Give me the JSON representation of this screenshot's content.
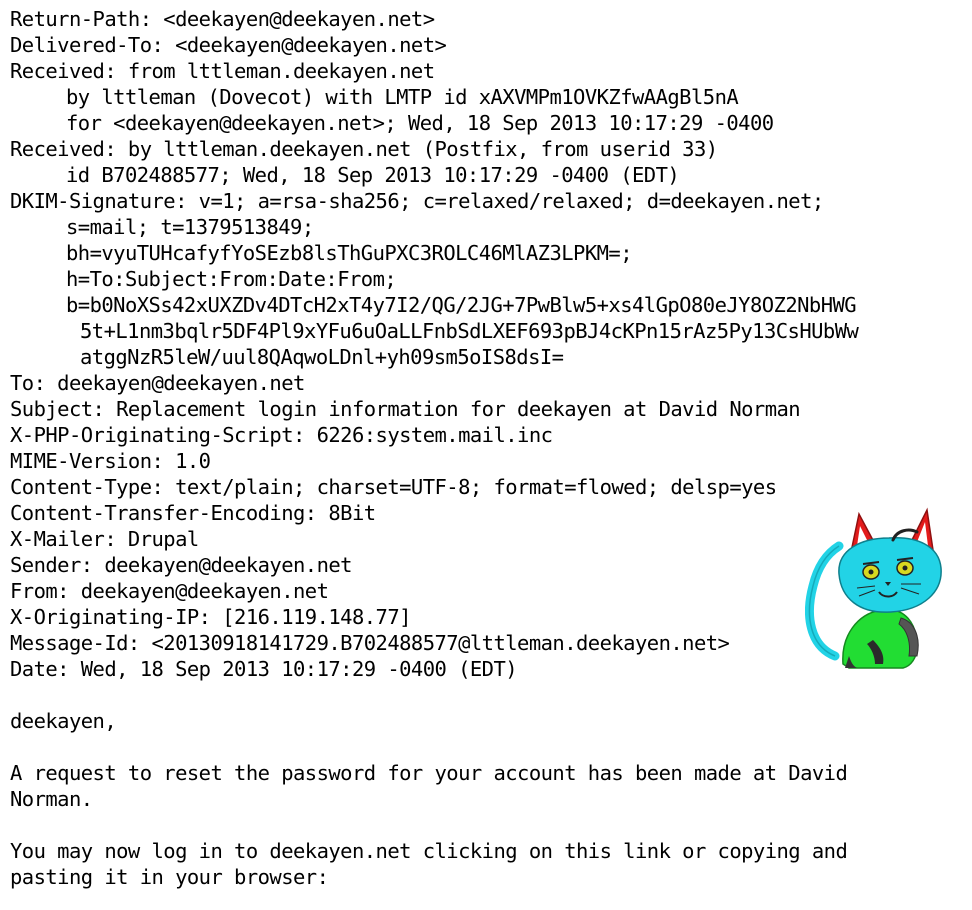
{
  "headers": [
    {
      "text": "Return-Path: <deekayen@deekayen.net>",
      "indent": 0
    },
    {
      "text": "Delivered-To: <deekayen@deekayen.net>",
      "indent": 0
    },
    {
      "text": "Received: from lttleman.deekayen.net",
      "indent": 0
    },
    {
      "text": "by lttleman (Dovecot) with LMTP id xAXVMPm1OVKZfwAAgBl5nA",
      "indent": 1
    },
    {
      "text": "for <deekayen@deekayen.net>; Wed, 18 Sep 2013 10:17:29 -0400",
      "indent": 1
    },
    {
      "text": "Received: by lttleman.deekayen.net (Postfix, from userid 33)",
      "indent": 0
    },
    {
      "text": "id B702488577; Wed, 18 Sep 2013 10:17:29 -0400 (EDT)",
      "indent": 1
    },
    {
      "text": "DKIM-Signature: v=1; a=rsa-sha256; c=relaxed/relaxed; d=deekayen.net;",
      "indent": 0
    },
    {
      "text": "s=mail; t=1379513849;",
      "indent": 1
    },
    {
      "text": "bh=vyuTUHcafyfYoSEzb8lsThGuPXC3ROLC46MlAZ3LPKM=;",
      "indent": 1
    },
    {
      "text": "h=To:Subject:From:Date:From;",
      "indent": 1
    },
    {
      "text": "b=b0NoXSs42xUXZDv4DTcH2xT4y7I2/QG/2JG+7PwBlw5+xs4lGpO80eJY8OZ2NbHWG",
      "indent": 1
    },
    {
      "text": "5t+L1nm3bqlr5DF4Pl9xYFu6uOaLLFnbSdLXEF693pBJ4cKPn15rAz5Py13CsHUbWw",
      "indent": 2
    },
    {
      "text": "atggNzR5leW/uul8QAqwoLDnl+yh09sm5oIS8dsI=",
      "indent": 2
    },
    {
      "text": "To: deekayen@deekayen.net",
      "indent": 0
    },
    {
      "text": "Subject: Replacement login information for deekayen at David Norman",
      "indent": 0
    },
    {
      "text": "X-PHP-Originating-Script: 6226:system.mail.inc",
      "indent": 0
    },
    {
      "text": "MIME-Version: 1.0",
      "indent": 0
    },
    {
      "text": "Content-Type: text/plain; charset=UTF-8; format=flowed; delsp=yes",
      "indent": 0
    },
    {
      "text": "Content-Transfer-Encoding: 8Bit",
      "indent": 0
    },
    {
      "text": "X-Mailer: Drupal",
      "indent": 0
    },
    {
      "text": "Sender: deekayen@deekayen.net",
      "indent": 0
    },
    {
      "text": "From: deekayen@deekayen.net",
      "indent": 0
    },
    {
      "text": "X-Originating-IP: [216.119.148.77]",
      "indent": 0
    },
    {
      "text": "Message-Id: <20130918141729.B702488577@lttleman.deekayen.net>",
      "indent": 0
    },
    {
      "text": "Date: Wed, 18 Sep 2013 10:17:29 -0400 (EDT)",
      "indent": 0
    }
  ],
  "body": [
    "",
    "deekayen,",
    "",
    "A request to reset the password for your account has been made at David",
    "Norman.",
    "",
    "You may now log in to deekayen.net clicking on this link or copying and",
    "pasting it in your browser:"
  ],
  "colors": {
    "text": "#000000",
    "background": "#ffffff",
    "cat_face": "#22d3e6",
    "cat_body": "#22dd33",
    "cat_ears": "#e31b1b"
  }
}
